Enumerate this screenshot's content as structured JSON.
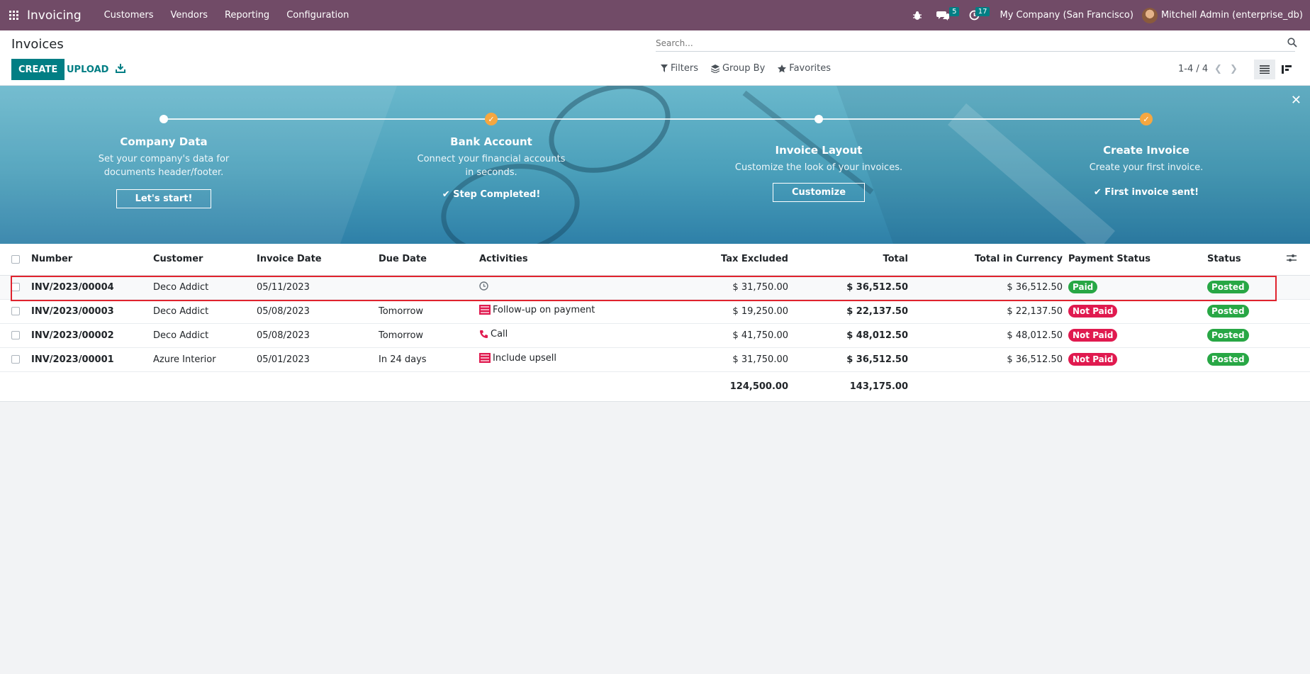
{
  "navbar": {
    "app_name": "Invoicing",
    "menu": [
      "Customers",
      "Vendors",
      "Reporting",
      "Configuration"
    ],
    "messages_count": "5",
    "activities_count": "17",
    "company": "My Company (San Francisco)",
    "user": "Mitchell Admin (enterprise_db)"
  },
  "control": {
    "title": "Invoices",
    "create_label": "CREATE",
    "upload_label": "UPLOAD",
    "search_placeholder": "Search...",
    "filters_label": "Filters",
    "groupby_label": "Group By",
    "favorites_label": "Favorites",
    "pager": "1-4 / 4"
  },
  "banner": {
    "steps": [
      {
        "title": "Company Data",
        "desc": "Set your company's data for documents header/footer.",
        "button": "Let's start!",
        "done": false
      },
      {
        "title": "Bank Account",
        "desc": "Connect your financial accounts in seconds.",
        "done_text": "Step Completed!",
        "done": true
      },
      {
        "title": "Invoice Layout",
        "desc": "Customize the look of your invoices.",
        "button": "Customize",
        "done": false
      },
      {
        "title": "Create Invoice",
        "desc": "Create your first invoice.",
        "done_text": "First invoice sent!",
        "done": true
      }
    ]
  },
  "table": {
    "headers": {
      "number": "Number",
      "customer": "Customer",
      "invoice_date": "Invoice Date",
      "due_date": "Due Date",
      "activities": "Activities",
      "tax_excluded": "Tax Excluded",
      "total": "Total",
      "total_currency": "Total in Currency",
      "payment_status": "Payment Status",
      "status": "Status"
    },
    "rows": [
      {
        "number": "INV/2023/00004",
        "customer": "Deco Addict",
        "invoice_date": "05/11/2023",
        "due_date": "",
        "activity": "",
        "activity_icon": "clock-icon",
        "tax_excluded": "$ 31,750.00",
        "total": "$ 36,512.50",
        "total_currency": "$ 36,512.50",
        "payment_status": "Paid",
        "status": "Posted"
      },
      {
        "number": "INV/2023/00003",
        "customer": "Deco Addict",
        "invoice_date": "05/08/2023",
        "due_date": "Tomorrow",
        "activity": "Follow-up on payment",
        "activity_icon": "tasks-icon",
        "tax_excluded": "$ 19,250.00",
        "total": "$ 22,137.50",
        "total_currency": "$ 22,137.50",
        "payment_status": "Not Paid",
        "status": "Posted"
      },
      {
        "number": "INV/2023/00002",
        "customer": "Deco Addict",
        "invoice_date": "05/08/2023",
        "due_date": "Tomorrow",
        "activity": "Call",
        "activity_icon": "phone-icon",
        "tax_excluded": "$ 41,750.00",
        "total": "$ 48,012.50",
        "total_currency": "$ 48,012.50",
        "payment_status": "Not Paid",
        "status": "Posted"
      },
      {
        "number": "INV/2023/00001",
        "customer": "Azure Interior",
        "invoice_date": "05/01/2023",
        "due_date": "In 24 days",
        "activity": "Include upsell",
        "activity_icon": "tasks-icon",
        "tax_excluded": "$ 31,750.00",
        "total": "$ 36,512.50",
        "total_currency": "$ 36,512.50",
        "payment_status": "Not Paid",
        "status": "Posted"
      }
    ],
    "totals": {
      "tax_excluded": "124,500.00",
      "total": "143,175.00"
    }
  },
  "colors": {
    "navbar": "#714b67",
    "primary": "#017e84",
    "paid": "#28a745",
    "not_paid": "#e01a4f",
    "highlight": "#e0232e"
  }
}
